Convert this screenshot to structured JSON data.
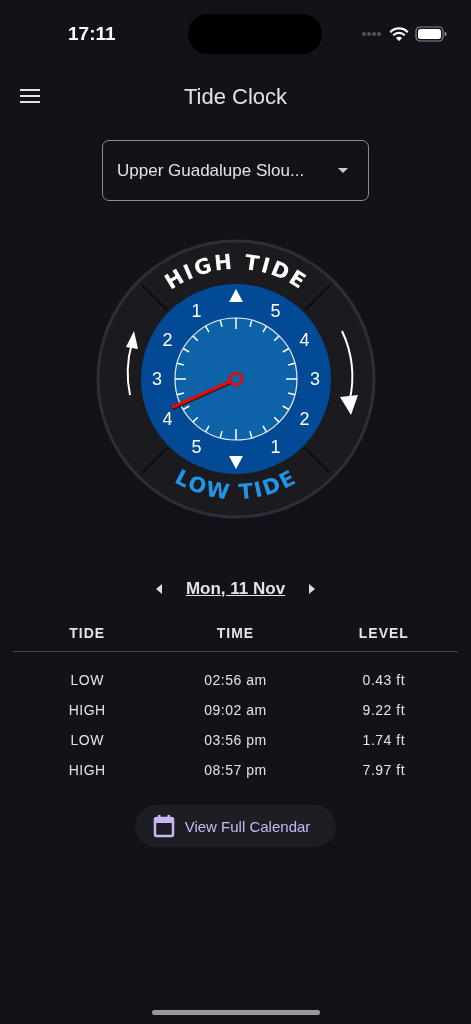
{
  "status_bar": {
    "time": "17:11"
  },
  "app_bar": {
    "title": "Tide Clock"
  },
  "location_dropdown": {
    "value": "Upper Guadalupe Slou..."
  },
  "clock": {
    "top_label": "HIGH TIDE",
    "bottom_label": "LOW TIDE",
    "left_numbers": [
      "1",
      "2",
      "3",
      "4",
      "5"
    ],
    "right_numbers": [
      "5",
      "4",
      "3",
      "2",
      "1"
    ]
  },
  "date_nav": {
    "date": "Mon, 11 Nov"
  },
  "table": {
    "columns": [
      "TIDE",
      "TIME",
      "LEVEL"
    ],
    "rows": [
      [
        "LOW",
        "02:56 am",
        "0.43 ft"
      ],
      [
        "HIGH",
        "09:02 am",
        "9.22 ft"
      ],
      [
        "LOW",
        "03:56 pm",
        "1.74 ft"
      ],
      [
        "HIGH",
        "08:57 pm",
        "7.97 ft"
      ]
    ]
  },
  "calendar_button": {
    "label": "View Full Calendar"
  }
}
